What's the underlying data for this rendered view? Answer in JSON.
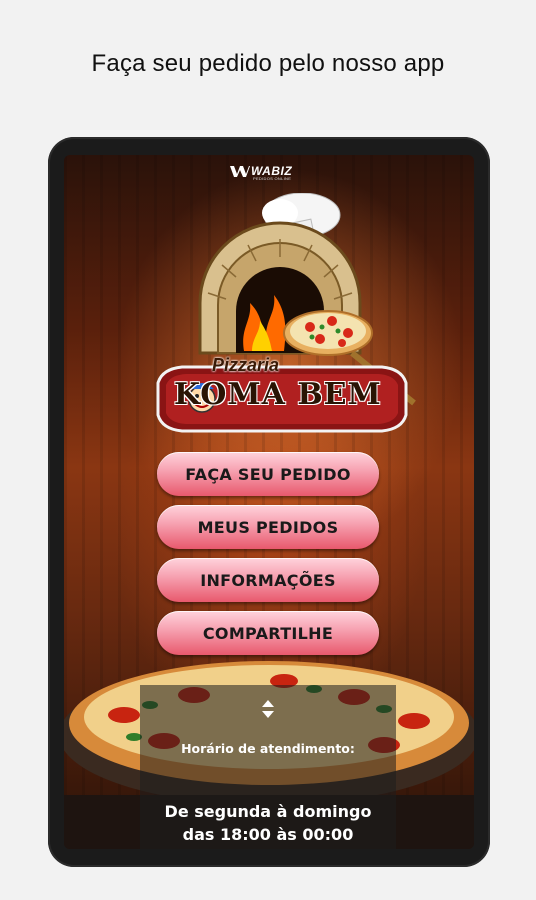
{
  "headline": "Faça seu pedido pelo nosso app",
  "brand": {
    "name": "WABIZ",
    "tagline": "PEDIDOS ONLINE"
  },
  "logo": {
    "top_text": "Pizzaria",
    "main_text": "KOMA BEM"
  },
  "menu": [
    {
      "label": "FAÇA SEU PEDIDO"
    },
    {
      "label": "MEUS PEDIDOS"
    },
    {
      "label": "INFORMAÇÕES"
    },
    {
      "label": "COMPARTILHE"
    }
  ],
  "hours": {
    "label": "Horário de atendimento:",
    "days": "De segunda à domingo",
    "time": "das 18:00 às 00:00"
  },
  "colors": {
    "button_gradient_top": "#ffd3dc",
    "button_gradient_bottom": "#e8596d"
  }
}
